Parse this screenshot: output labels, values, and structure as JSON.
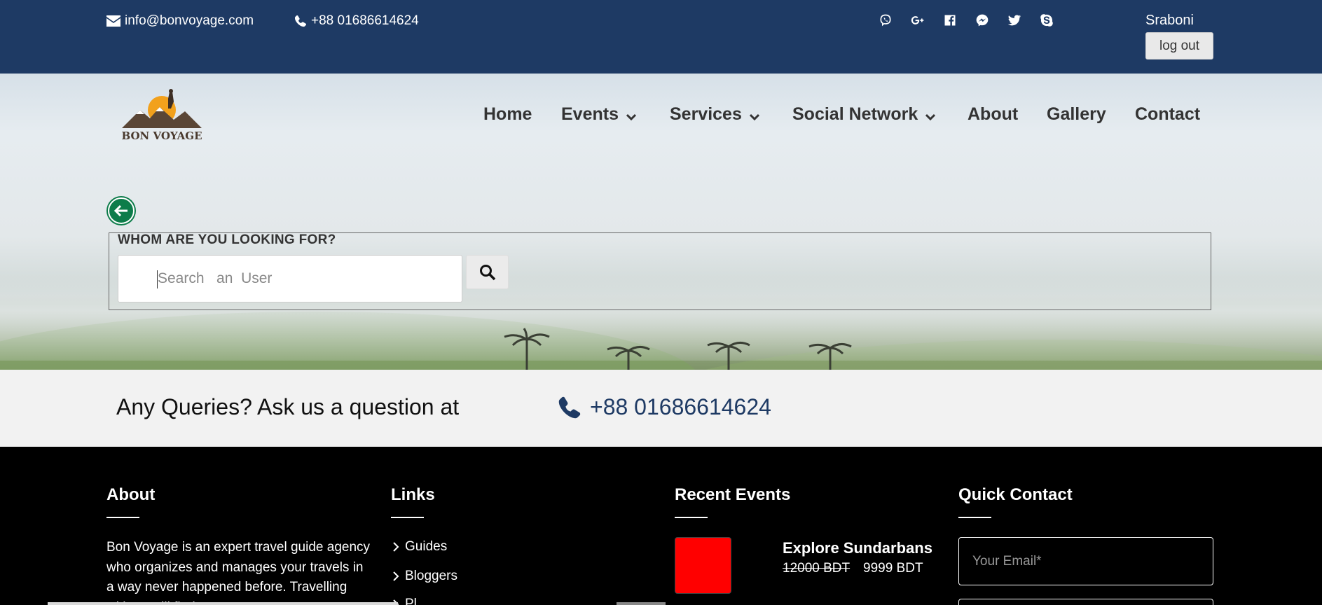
{
  "topbar": {
    "email": "info@bonvoyage.com",
    "phone": "+88 01686614624",
    "socials": [
      "viber-icon",
      "google-plus-icon",
      "facebook-icon",
      "messenger-icon",
      "twitter-icon",
      "skype-icon"
    ],
    "username": "Sraboni",
    "logout_label": "log out"
  },
  "logo": {
    "text": "BON VOYAGE"
  },
  "nav": {
    "items": [
      {
        "label": "Home",
        "dropdown": false
      },
      {
        "label": "Events",
        "dropdown": true
      },
      {
        "label": "Services",
        "dropdown": true
      },
      {
        "label": "Social Network",
        "dropdown": true
      },
      {
        "label": "About",
        "dropdown": false
      },
      {
        "label": "Gallery",
        "dropdown": false
      },
      {
        "label": "Contact",
        "dropdown": false
      }
    ]
  },
  "search": {
    "legend": "WHOM ARE YOU LOOKING FOR?",
    "placeholder": "Search   an  User"
  },
  "queries": {
    "text": "Any Queries? Ask us a question at",
    "phone": "+88 01686614624"
  },
  "footer": {
    "about": {
      "title": "About",
      "text": "Bon Voyage is an expert travel guide agency who organizes and manages your travels in a way never happened before. Travelling with us will find your"
    },
    "links": {
      "title": "Links",
      "items": [
        "Guides",
        "Bloggers",
        "Pl"
      ]
    },
    "recent_events": {
      "title": "Recent Events",
      "event": {
        "title": "Explore Sundarbans",
        "old_price": "12000 BDT",
        "new_price": "9999 BDT"
      }
    },
    "quick_contact": {
      "title": "Quick Contact",
      "email_placeholder": "Your Email*"
    }
  },
  "colors": {
    "topbar": "#1e3a64",
    "accent_green": "#0d7c4a",
    "event_thumb": "#ff0000",
    "queries_bg": "#f2f2f2"
  }
}
